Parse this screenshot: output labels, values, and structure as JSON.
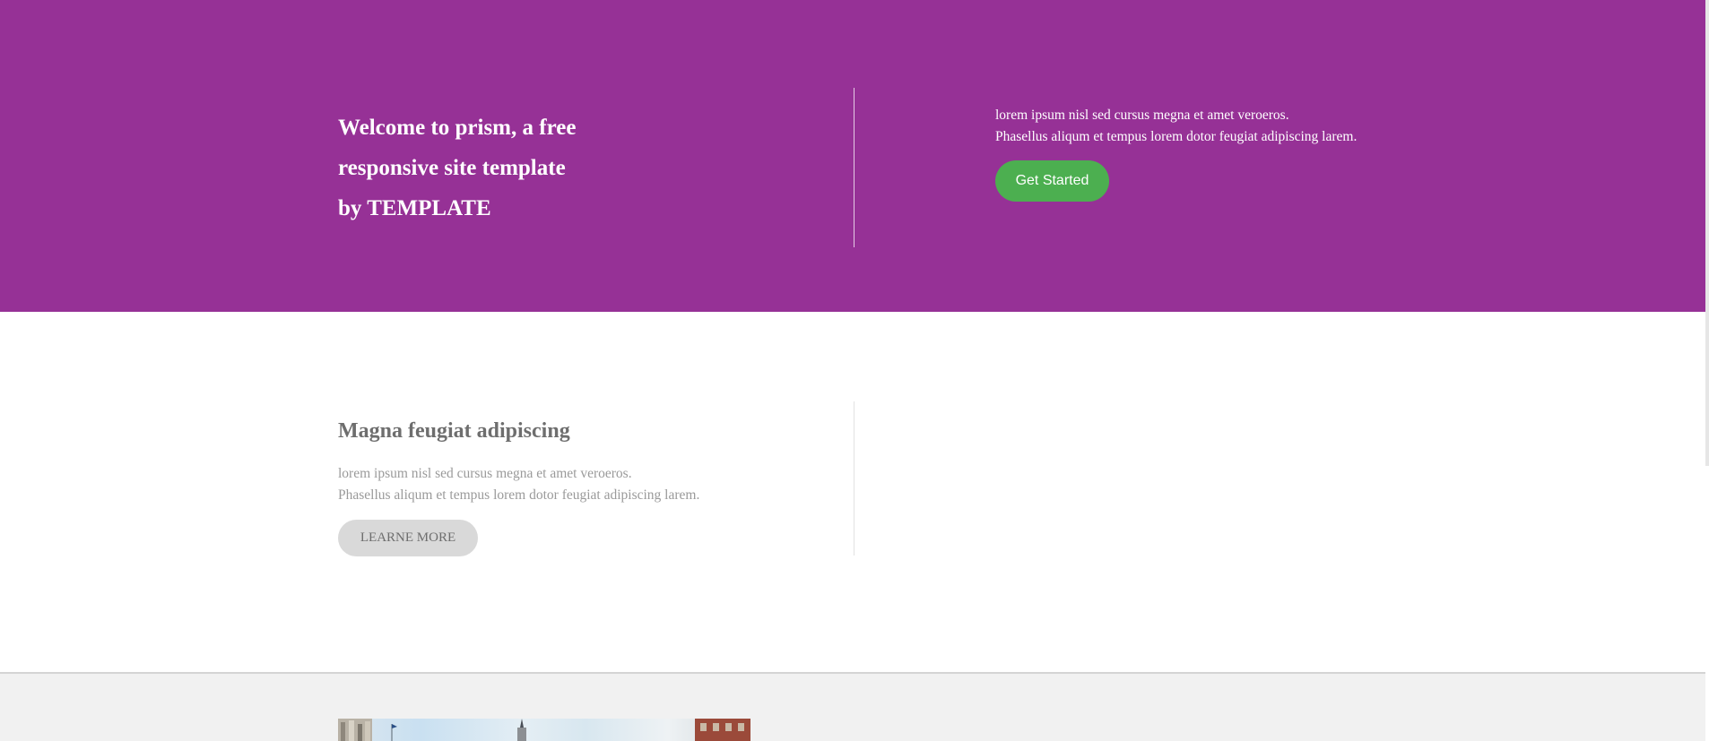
{
  "hero": {
    "title_lines": [
      "Welcome to prism, a free",
      "responsive site template",
      "by TEMPLATE"
    ],
    "text_lines": [
      "lorem ipsum nisl sed cursus megna et amet veroeros.",
      "Phasellus aliqum et tempus lorem dotor feugiat adipiscing larem."
    ],
    "button_label": "Get Started",
    "background_color": "#963196",
    "button_color": "#4caf50"
  },
  "feature": {
    "title": "Magna feugiat adipiscing",
    "text_lines": [
      "lorem ipsum nisl sed cursus megna et amet veroeros.",
      "Phasellus aliqum et tempus lorem dotor feugiat adipiscing larem."
    ],
    "button_label": "LEARNE MORE"
  },
  "gallery": {
    "image_icon": "city-photo"
  }
}
